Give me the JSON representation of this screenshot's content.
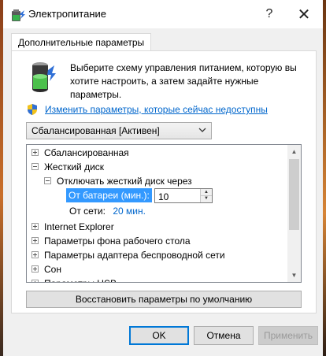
{
  "window": {
    "title": "Электропитание",
    "help_label": "?",
    "close_label": "✕"
  },
  "tab": {
    "label": "Дополнительные параметры"
  },
  "intro": {
    "text": "Выберите схему управления питанием, которую вы хотите настроить, а затем задайте нужные параметры."
  },
  "link": {
    "text": "Изменить параметры, которые сейчас недоступны"
  },
  "plan_select": {
    "value": "Сбалансированная [Активен]"
  },
  "tree": {
    "balanced": "Сбалансированная",
    "hard_disk": "Жесткий диск",
    "turn_off_disk": "Отключать жесткий диск через",
    "on_battery_label": "От батареи (мин.):",
    "on_battery_value": "10",
    "plugged_in_label": "От сети:",
    "plugged_in_value": "20 мин.",
    "internet_explorer": "Internet Explorer",
    "desktop_bg": "Параметры фона рабочего стола",
    "wireless_adapter": "Параметры адаптера беспроводной сети",
    "sleep": "Сон",
    "usb": "Параметры USB"
  },
  "restore_button": "Восстановить параметры по умолчанию",
  "footer": {
    "ok": "OK",
    "cancel": "Отмена",
    "apply": "Применить"
  },
  "colors": {
    "accent": "#0078d7",
    "selection": "#3399ff",
    "link": "#0066cc"
  }
}
